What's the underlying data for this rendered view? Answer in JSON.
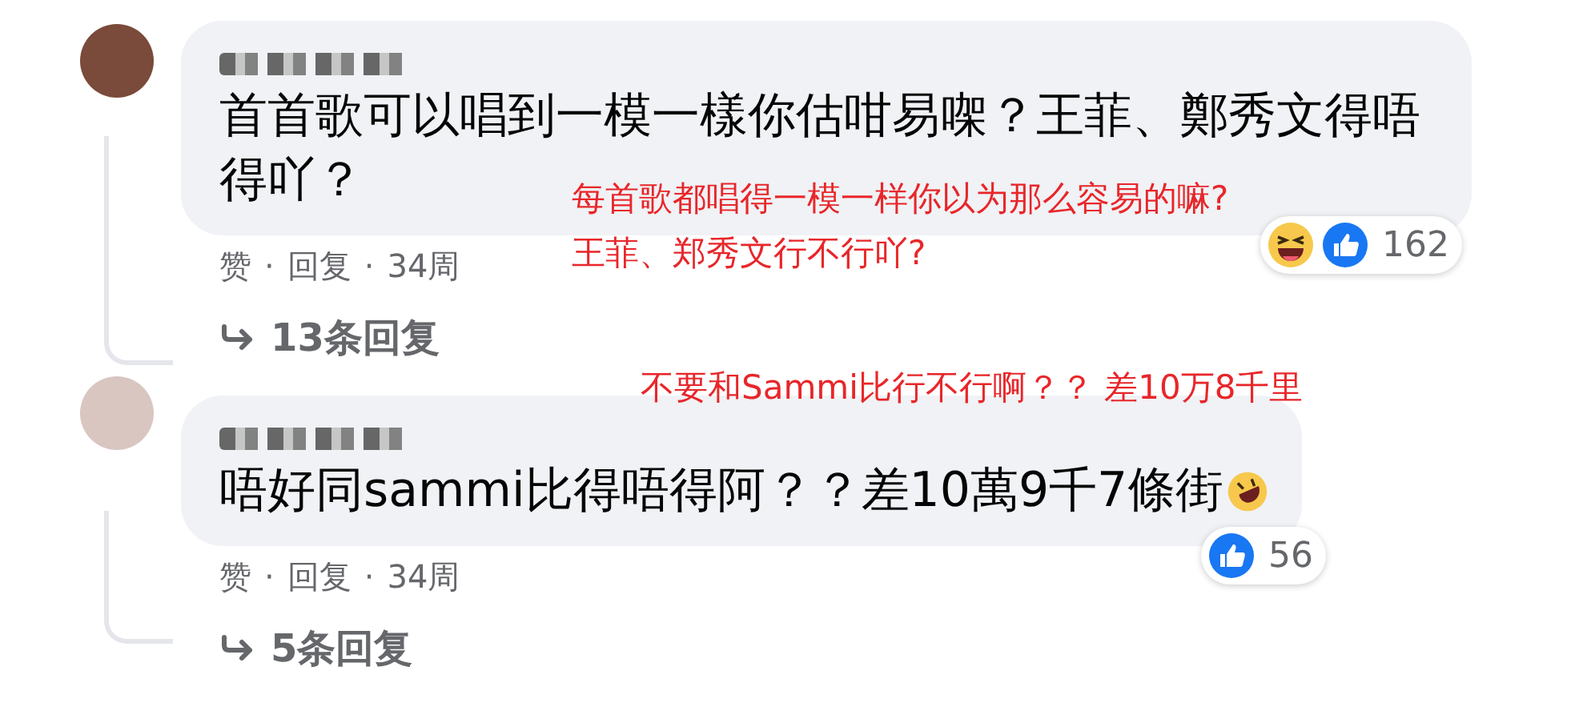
{
  "comments": [
    {
      "body_lines": [
        "首首歌可以唱到一模一樣你估咁易㗎？王菲、鄭秀文得唔",
        "得吖？"
      ],
      "trailing_emoji": false,
      "reactions": [
        {
          "kind": "haha"
        },
        {
          "kind": "like"
        }
      ],
      "reaction_count": "162",
      "actions": [
        {
          "label": "赞"
        },
        {
          "label": "回复"
        }
      ],
      "separator": "·",
      "time": "34周",
      "replies": "13条回复",
      "annotation": "每首歌都唱得一模一样你以为那么容易的嘛?\n王菲、郑秀文行不行吖?"
    },
    {
      "body_lines": [
        "唔好同sammi比得唔得阿？？差10萬9千7條街"
      ],
      "trailing_emoji": true,
      "reactions": [
        {
          "kind": "like"
        }
      ],
      "reaction_count": "56",
      "actions": [
        {
          "label": "赞"
        },
        {
          "label": "回复"
        }
      ],
      "separator": "·",
      "time": "34周",
      "replies": "5条回复",
      "annotation": "不要和Sammi比行不行啊？？ 差10万8千里"
    }
  ]
}
